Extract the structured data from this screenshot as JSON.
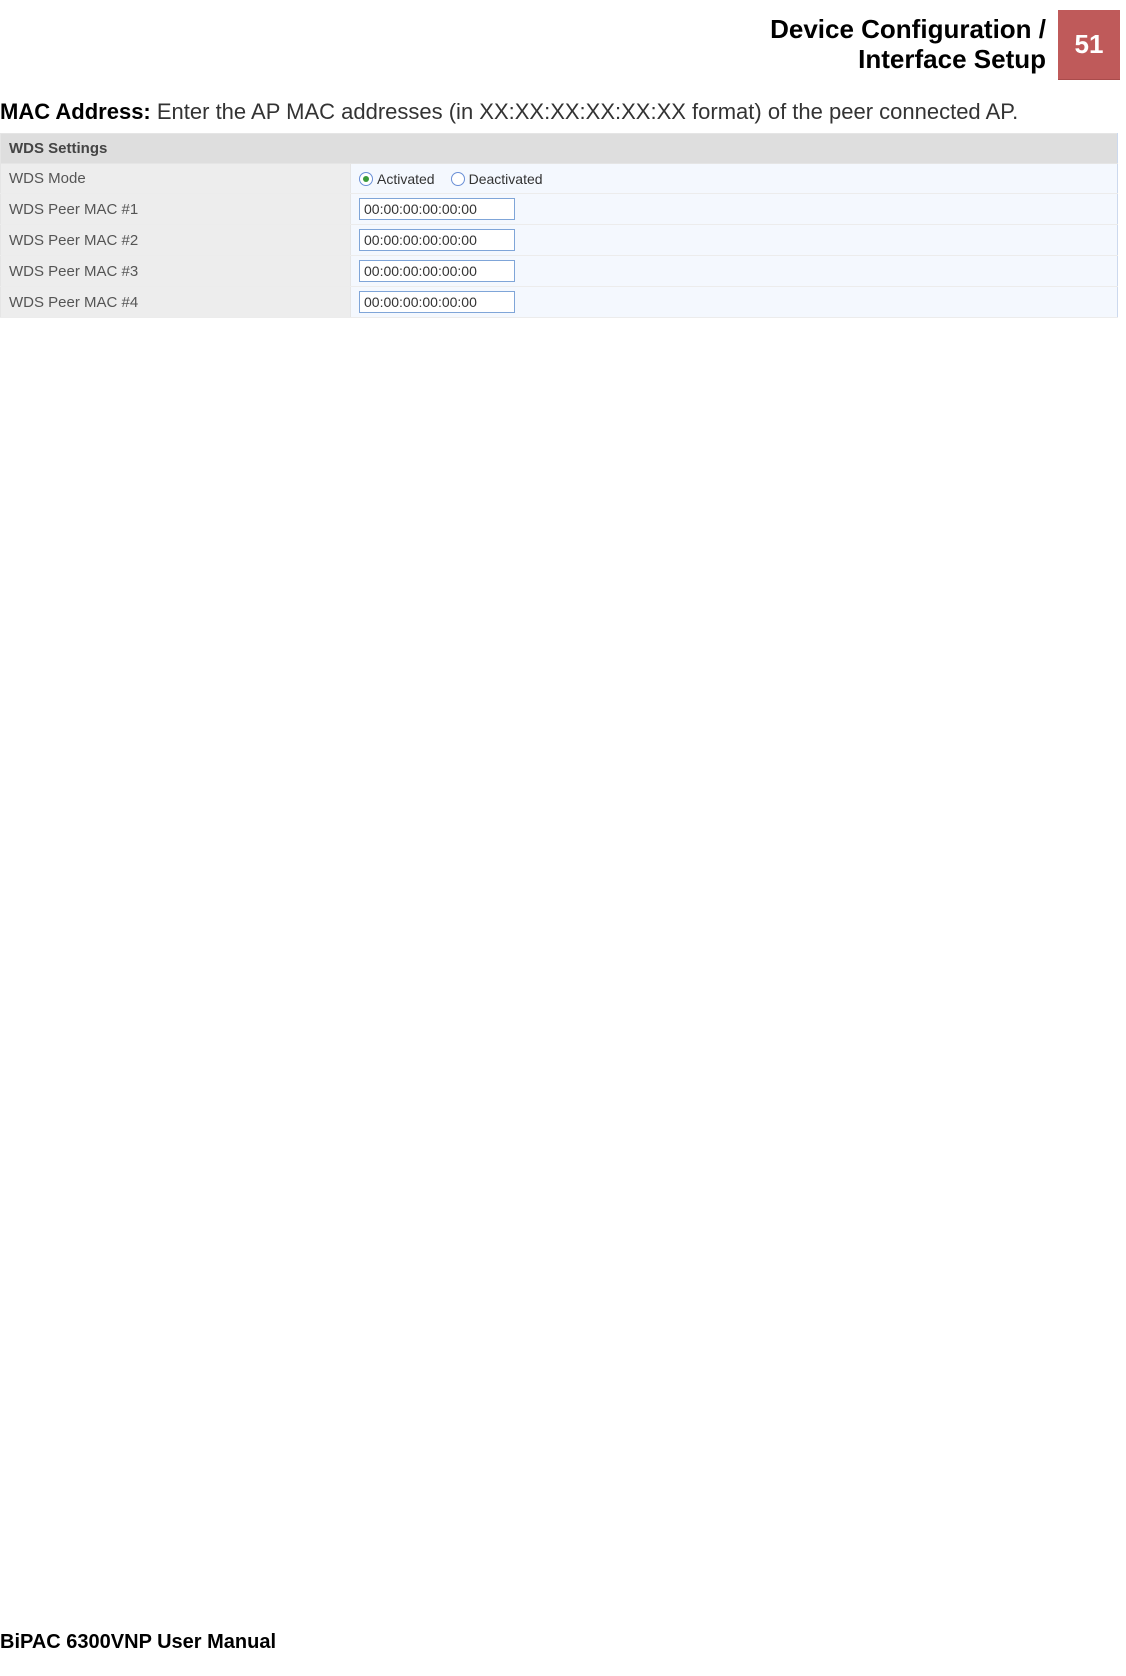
{
  "header": {
    "title_line1": "Device Configuration /",
    "title_line2": "Interface Setup",
    "page_number": "51"
  },
  "intro": {
    "label": "MAC Address:",
    "text": " Enter the AP MAC addresses (in XX:XX:XX:XX:XX:XX format) of the peer connected AP."
  },
  "wds": {
    "section_title": "WDS Settings",
    "mode_label": "WDS Mode",
    "mode_options": {
      "activated": "Activated",
      "deactivated": "Deactivated"
    },
    "peers": [
      {
        "label": "WDS Peer MAC #1",
        "value": "00:00:00:00:00:00"
      },
      {
        "label": "WDS Peer MAC #2",
        "value": "00:00:00:00:00:00"
      },
      {
        "label": "WDS Peer MAC #3",
        "value": "00:00:00:00:00:00"
      },
      {
        "label": "WDS Peer MAC #4",
        "value": "00:00:00:00:00:00"
      }
    ]
  },
  "footer": {
    "text": "BiPAC 6300VNP User Manual"
  }
}
